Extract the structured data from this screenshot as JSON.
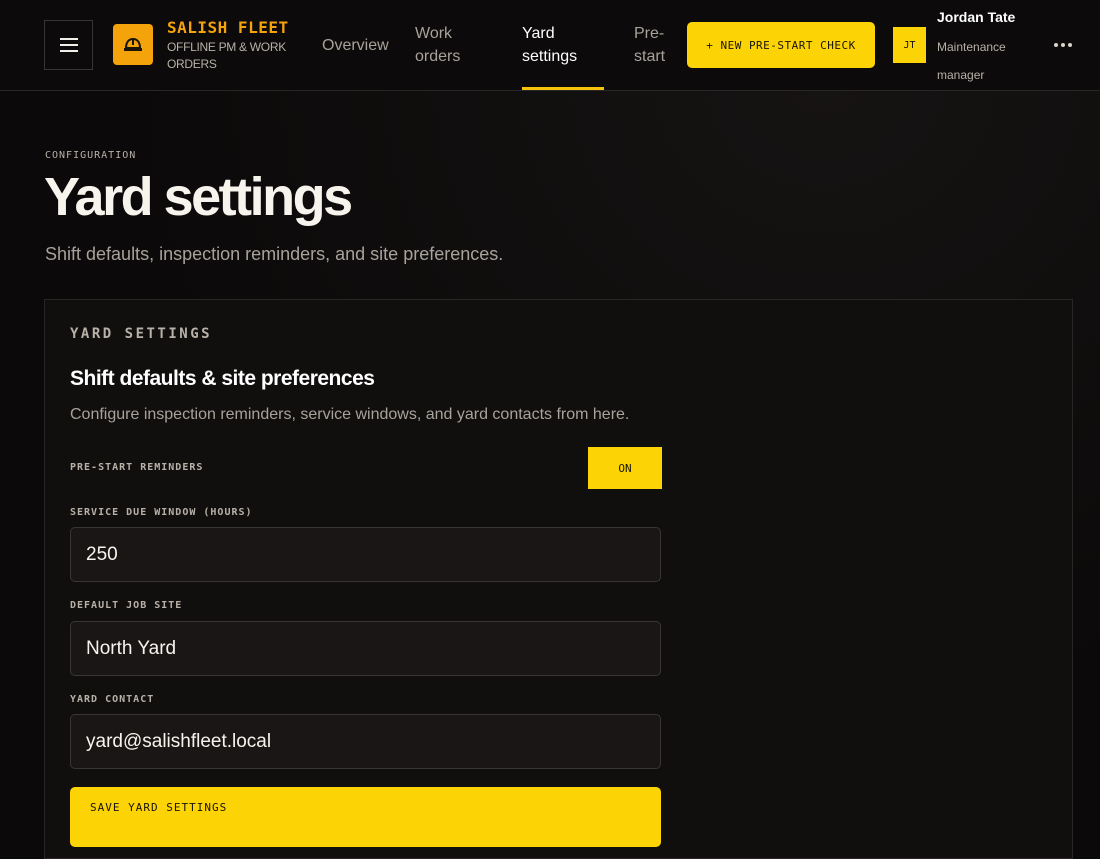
{
  "header": {
    "brand_name": "SALISH FLEET",
    "brand_subtitle": "OFFLINE PM & WORK ORDERS",
    "nav": [
      {
        "label": "Overview"
      },
      {
        "label": "Work orders"
      },
      {
        "label": "Yard settings"
      },
      {
        "label": "Pre-start"
      }
    ],
    "active_nav": "Yard settings",
    "cta_label": "+ NEW PRE-START CHECK",
    "user": {
      "initials": "JT",
      "name": "Jordan Tate",
      "role": "Maintenance manager"
    },
    "icons": {
      "menu": "hamburger-icon",
      "brand": "hard-hat-icon",
      "more": "more-horizontal-icon"
    }
  },
  "page": {
    "eyebrow": "CONFIGURATION",
    "title": "Yard settings",
    "subtitle": "Shift defaults, inspection reminders, and site preferences."
  },
  "card": {
    "eyebrow": "YARD SETTINGS",
    "title": "Shift defaults & site preferences",
    "description": "Configure inspection reminders, service windows, and yard contacts from here.",
    "reminders": {
      "label": "PRE-START REMINDERS",
      "value": "ON"
    },
    "service_window": {
      "label": "SERVICE DUE WINDOW (HOURS)",
      "value": "250"
    },
    "job_site": {
      "label": "DEFAULT JOB SITE",
      "value": "North Yard"
    },
    "contact": {
      "label": "YARD CONTACT",
      "value": "yard@salishfleet.local"
    },
    "save_label": "SAVE YARD SETTINGS"
  },
  "colors": {
    "accent": "#fcd305",
    "brand": "#f5a30a",
    "background": "#0b0909"
  }
}
